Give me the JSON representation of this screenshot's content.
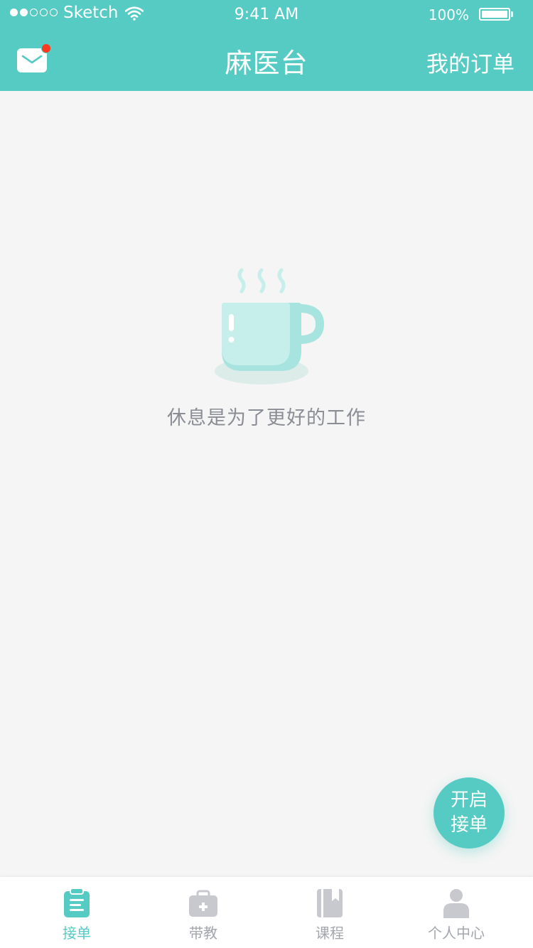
{
  "status_bar": {
    "carrier": "Sketch",
    "time": "9:41 AM",
    "battery": "100%"
  },
  "nav": {
    "title": "麻医台",
    "right_action": "我的订单",
    "mail_has_unread": true
  },
  "empty_state": {
    "icon": "coffee-cup-icon",
    "message": "休息是为了更好的工作"
  },
  "fab": {
    "line1": "开启",
    "line2": "接单"
  },
  "tabs": [
    {
      "label": "接单",
      "icon": "clipboard-icon",
      "active": true
    },
    {
      "label": "带教",
      "icon": "medical-kit-icon",
      "active": false
    },
    {
      "label": "课程",
      "icon": "book-icon",
      "active": false
    },
    {
      "label": "个人中心",
      "icon": "person-icon",
      "active": false
    }
  ],
  "colors": {
    "primary": "#56cbc3",
    "background": "#f4f5f4",
    "badge": "#fa3a1f",
    "tab_inactive": "#a3a6ac",
    "muted_text": "#8a8d94"
  }
}
